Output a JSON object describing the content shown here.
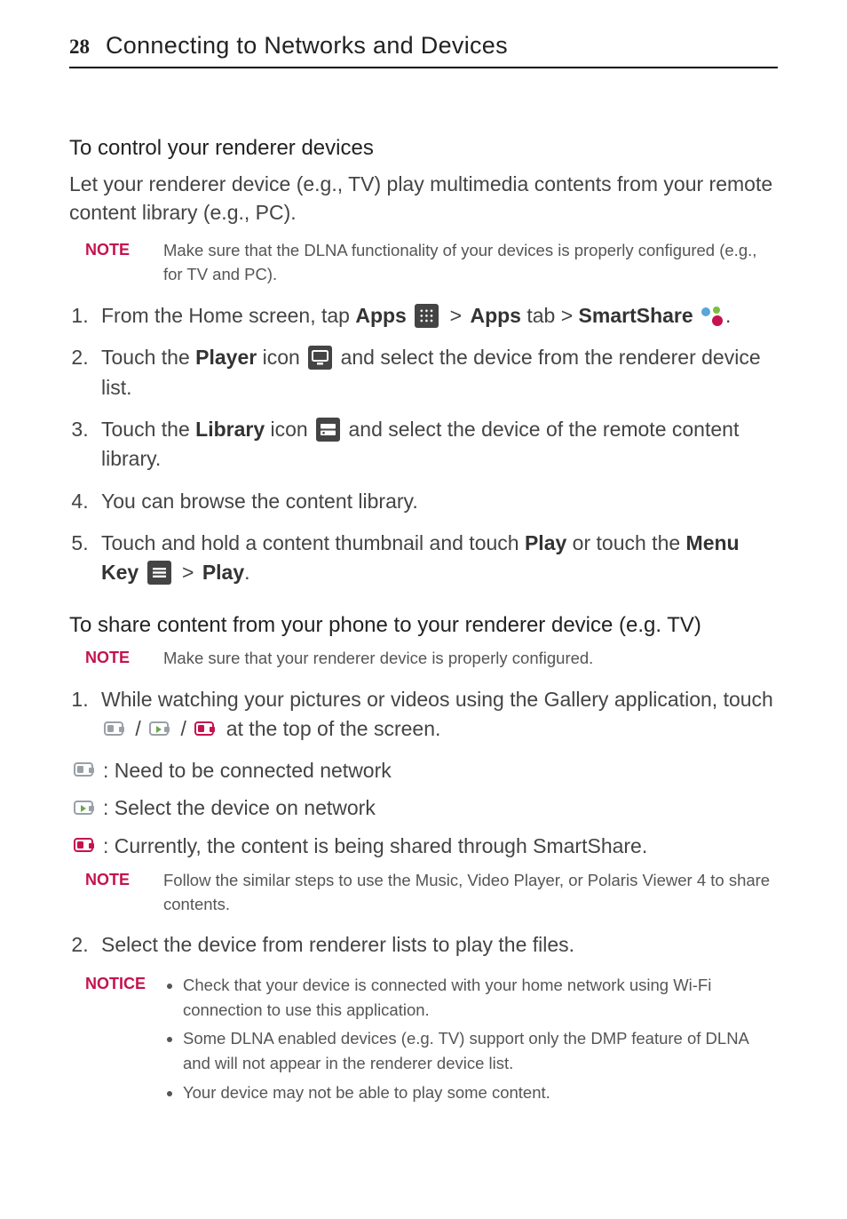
{
  "page_number": "28",
  "header_title": "Connecting to Networks and Devices",
  "section1": {
    "heading": "To control your renderer devices",
    "intro": "Let your renderer device (e.g., TV) play multimedia contents from your remote content library (e.g., PC).",
    "note_label": "NOTE",
    "note_body": "Make sure that the DLNA functionality of your devices is properly configured (e.g., for TV and PC).",
    "steps": {
      "s1_a": "From the Home screen, tap ",
      "s1_apps": "Apps",
      "s1_gt1": " > ",
      "s1_apps_tab": "Apps",
      "s1_tab_word": " tab > ",
      "s1_smartshare": "SmartShare",
      "s1_end": ".",
      "s2_a": "Touch the ",
      "s2_player": "Player",
      "s2_b": " icon ",
      "s2_c": " and select the device from the renderer device list.",
      "s3_a": "Touch the ",
      "s3_library": "Library",
      "s3_b": " icon ",
      "s3_c": " and select the device of the remote content library.",
      "s4": "You can browse the content library.",
      "s5_a": "Touch and hold a content thumbnail and touch ",
      "s5_play": "Play",
      "s5_b": " or touch the ",
      "s5_menu": "Menu Key",
      "s5_gt": " > ",
      "s5_play2": "Play",
      "s5_end": "."
    }
  },
  "section2": {
    "heading": "To share content from your phone to your renderer device (e.g. TV)",
    "note1_label": "NOTE",
    "note1_body": "Make sure that your renderer device is properly configured.",
    "step1_a": "While watching your pictures or videos using the Gallery application, touch ",
    "step1_b": " / ",
    "step1_c": " / ",
    "step1_d": " at the top of the screen.",
    "legend1": " : Need to be connected network",
    "legend2": " : Select the device on network",
    "legend3": " : Currently, the content is being shared through SmartShare.",
    "note2_label": "NOTE",
    "note2_body": "Follow the similar steps to use the Music, Video Player, or Polaris Viewer 4 to share contents.",
    "step2": "Select the device from renderer lists to play the files.",
    "notice_label": "NOTICE",
    "notice_bullets": [
      "Check that your device is connected with your home network using Wi-Fi connection to use this application.",
      "Some DLNA enabled devices (e.g. TV) support only the DMP feature of DLNA and will not appear in the renderer device list.",
      "Your device may not be able to play some content."
    ]
  }
}
